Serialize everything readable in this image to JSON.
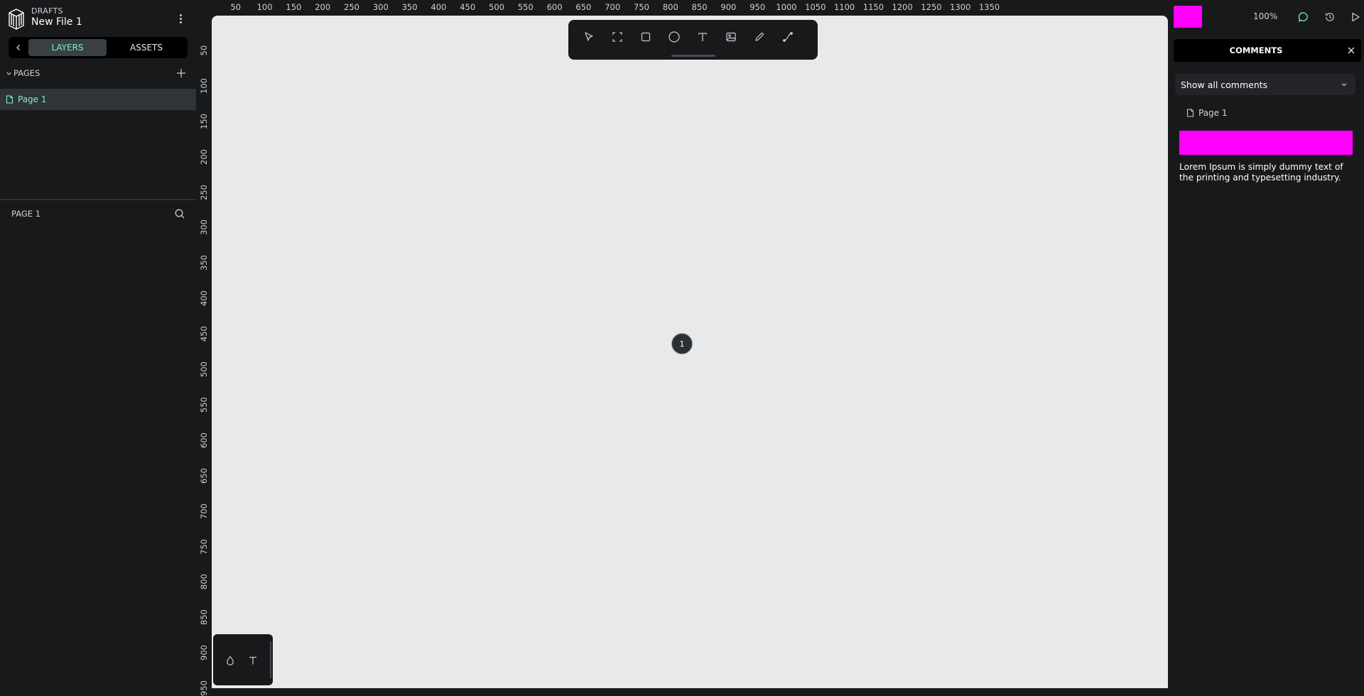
{
  "header": {
    "project_label": "DRAFTS",
    "file_name": "New File 1"
  },
  "sidebar": {
    "tabs": [
      {
        "label": "LAYERS",
        "active": true
      },
      {
        "label": "ASSETS",
        "active": false
      }
    ],
    "pages_label": "PAGES",
    "pages": [
      {
        "label": "Page 1",
        "selected": true
      }
    ],
    "layers_title": "PAGE 1"
  },
  "rulers": {
    "horizontal": [
      "50",
      "100",
      "150",
      "200",
      "250",
      "300",
      "350",
      "400",
      "450",
      "500",
      "550",
      "600",
      "650",
      "700",
      "750",
      "800",
      "850",
      "900",
      "950",
      "1000",
      "1050",
      "1100",
      "1150",
      "1200",
      "1250",
      "1300",
      "1350"
    ],
    "vertical": [
      "50",
      "100",
      "150",
      "200",
      "250",
      "300",
      "350",
      "400",
      "450",
      "500",
      "550",
      "600",
      "650",
      "700",
      "750",
      "800",
      "850",
      "900",
      "950"
    ]
  },
  "toolbar": {
    "tools": [
      "pointer-icon",
      "board-icon",
      "rectangle-icon",
      "ellipse-icon",
      "text-icon",
      "image-icon",
      "pencil-icon",
      "path-icon"
    ]
  },
  "canvas": {
    "comment_pin_number": "1",
    "palette_tools": [
      "drop-icon",
      "typography-icon"
    ]
  },
  "right_panel": {
    "zoom": "100%",
    "comments_title": "COMMENTS",
    "filter_value": "Show all comments",
    "thread_page": "Page 1",
    "comment_text": "Lorem Ipsum is simply dummy text of the printing and typesetting industry."
  },
  "colors": {
    "accent": "#7ff0c8",
    "highlight": "#ff00ff",
    "panel_bg": "#18191b",
    "canvas_bg": "#e8e9ea"
  }
}
